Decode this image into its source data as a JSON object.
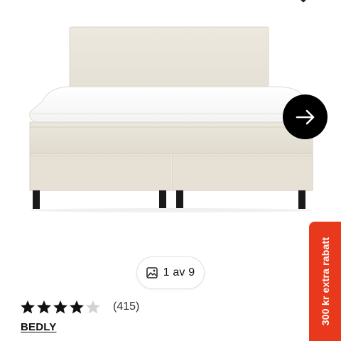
{
  "product": {
    "image_alt": "",
    "gallery": {
      "current": 1,
      "total": 9,
      "counter_text": "1 av 9"
    },
    "rating": {
      "stars": 4,
      "max_stars": 5,
      "count_text": "(415)"
    },
    "brand": "BEDLY"
  },
  "promo": {
    "label": "300 kr extra rabatt",
    "color": "#e8391c"
  },
  "icons": {
    "next": "arrow-right-icon",
    "favorite": "heart-icon",
    "gallery": "image-icon",
    "star": "star-icon"
  }
}
